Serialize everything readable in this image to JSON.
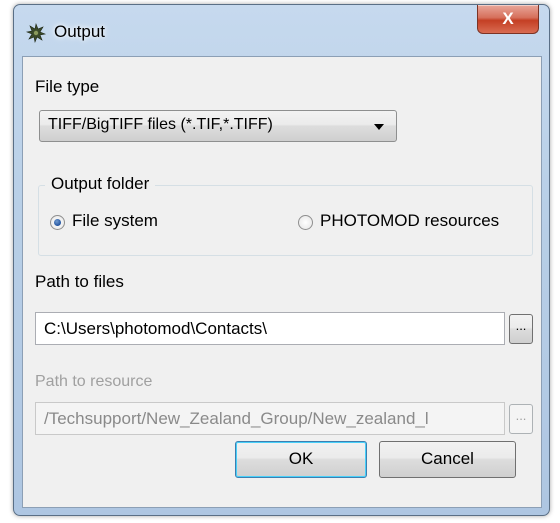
{
  "window": {
    "title": "Output",
    "close_label": "X"
  },
  "file_type": {
    "label": "File type",
    "selected": "TIFF/BigTIFF files (*.TIF,*.TIFF)"
  },
  "output_folder": {
    "legend": "Output folder",
    "options": [
      {
        "label": "File system",
        "checked": true
      },
      {
        "label": "PHOTOMOD resources",
        "checked": false
      }
    ]
  },
  "path_to_files": {
    "label": "Path to files",
    "value": "C:\\Users\\photomod\\Contacts\\",
    "browse_label": "..."
  },
  "path_to_resource": {
    "label": "Path to resource",
    "value": "/Techsupport/New_Zealand_Group/New_zealand_l",
    "browse_label": "..."
  },
  "buttons": {
    "ok": "OK",
    "cancel": "Cancel"
  },
  "colors": {
    "frame": "#b8cfe7",
    "client": "#f0f0f0",
    "close": "#c43f24",
    "disabled_text": "#a0a0a0"
  }
}
